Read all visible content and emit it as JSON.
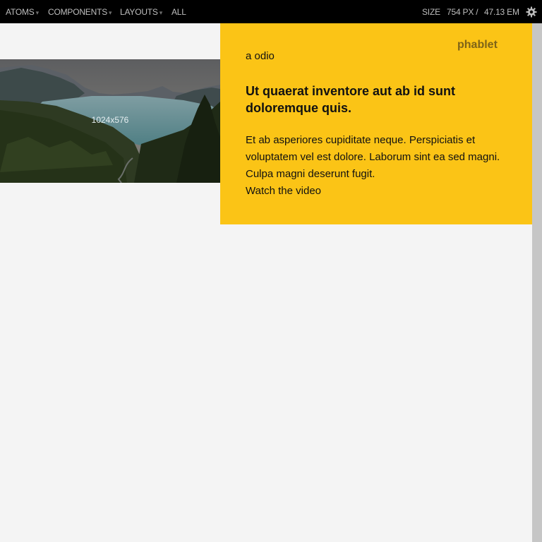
{
  "nav": {
    "items": [
      {
        "label": "ATOMS",
        "has_caret": true
      },
      {
        "label": "COMPONENTS",
        "has_caret": true
      },
      {
        "label": "LAYOUTS",
        "has_caret": true
      },
      {
        "label": "ALL",
        "has_caret": false
      }
    ],
    "caret_glyph": "▾",
    "size_label": "SIZE",
    "size_px": "754 PX /",
    "size_em": "47.13 EM",
    "settings_icon": "gear-icon"
  },
  "hero": {
    "caption": "1024x576",
    "image_icon": "landscape-photo"
  },
  "card": {
    "badge": "phablet",
    "kicker": "a odio",
    "headline": "Ut quaerat inventore aut ab id sunt doloremque quis.",
    "body": "Et ab asperiores cupiditate neque. Perspiciatis et voluptatem vel est dolore. Laborum sint ea sed magni. Culpa magni deserunt fugit.",
    "link": "Watch the video"
  },
  "colors": {
    "toolbar_bg": "#000000",
    "toolbar_text": "#bdbdbd",
    "card_bg": "#fbc416",
    "page_bg": "#f4f4f4",
    "badge_text": "#7e6418"
  }
}
